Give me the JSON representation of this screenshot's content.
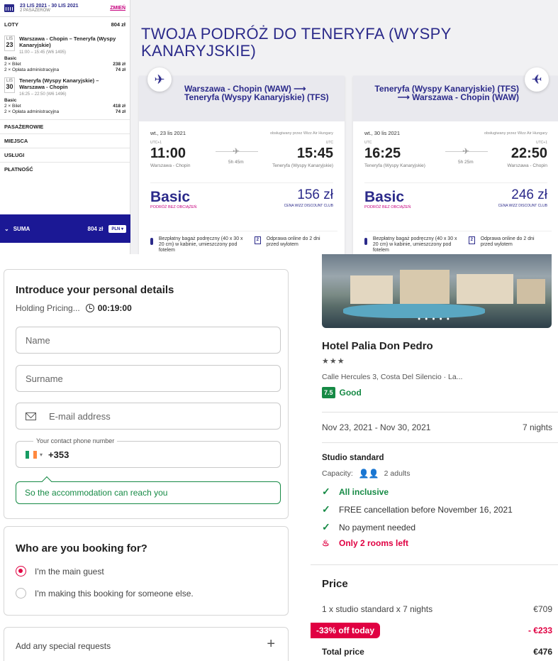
{
  "wizz": {
    "sidebar": {
      "dates": "23 LIS 2021 - 30 LIS 2021",
      "passengers": "2 PASAŻERÓW",
      "change": "ZMIEŃ",
      "flights_label": "LOTY",
      "flights_total": "804 zł",
      "out": {
        "month": "LIS",
        "day": "23",
        "route": "Warszawa - Chopin – Teneryfa (Wyspy Kanaryjskie)",
        "time": "11:00 – 15:45 (W6 1495)",
        "fare": "Basic",
        "ticket": "2 × Bilet",
        "ticket_price": "238 zł",
        "fee": "2 × Opłata administracyjna",
        "fee_price": "74 zł"
      },
      "ret": {
        "month": "LIS",
        "day": "30",
        "route": "Teneryfa (Wyspy Kanaryjskie) – Warszawa - Chopin",
        "time": "16:25 – 22:50 (W6 1496)",
        "fare": "Basic",
        "ticket": "2 × Bilet",
        "ticket_price": "418 zł",
        "fee": "2 × Opłata administracyjna",
        "fee_price": "74 zł"
      },
      "sections": [
        "PASAŻEROWIE",
        "MIEJSCA",
        "USŁUGI",
        "PŁATNOŚĆ"
      ],
      "sum_label": "SUMA",
      "sum_value": "804 zł",
      "currency": "PLN"
    },
    "title": "TWOJA PODRÓŻ DO TENERYFA (WYSPY KANARYJSKIE)",
    "cards": [
      {
        "route": "Warszawa - Chopin (WAW) ⟶ Teneryfa (Wyspy Kanaryjskie) (TFS)",
        "date": "wt., 23 lis 2021",
        "operator": "obsługiwany przez Wizz Air Hungary",
        "dep": "11:00",
        "arr": "15:45",
        "dep_tz": "UTC+1",
        "arr_tz": "UTC",
        "dep_city": "Warszawa - Chopin",
        "arr_city": "Teneryfa (Wyspy Kanaryjskie)",
        "duration": "5h 45m",
        "fare": "Basic",
        "fare_sub": "PODRÓŻ BEZ OBCIĄŻEŃ",
        "price": "156 zł",
        "price_sub": "CENA WIZZ DISCOUNT CLUB",
        "bag": "Bezpłatny bagaż podręczny (40 x 30 x 20 cm) w kabinie, umieszczony pod fotelem",
        "checkin": "Odprawa online do 2 dni przed wylotem",
        "cal_num": "2"
      },
      {
        "route": "Teneryfa (Wyspy Kanaryjskie) (TFS) ⟶ Warszawa - Chopin (WAW)",
        "date": "wt., 30 lis 2021",
        "operator": "obsługiwany przez Wizz Air Hungary",
        "dep": "16:25",
        "arr": "22:50",
        "dep_tz": "UTC",
        "arr_tz": "UTC+1",
        "dep_city": "Teneryfa (Wyspy Kanaryjskie)",
        "arr_city": "Warszawa - Chopin",
        "duration": "5h 25m",
        "fare": "Basic",
        "fare_sub": "PODRÓŻ BEZ OBCIĄŻEŃ",
        "price": "246 zł",
        "price_sub": "CENA WIZZ DISCOUNT CLUB",
        "bag": "Bezpłatny bagaż podręczny (40 x 30 x 20 cm) w kabinie, umieszczony pod fotelem",
        "checkin": "Odprawa online do 2 dni przed wylotem",
        "cal_num": "2"
      }
    ]
  },
  "form": {
    "title": "Introduce your personal details",
    "holding": "Holding Pricing...",
    "timer": "00:19:00",
    "name_ph": "Name",
    "surname_ph": "Surname",
    "email_ph": "E-mail address",
    "phone_label": "Your contact phone number",
    "phone_code": "+353",
    "hint": "So the accommodation can reach you",
    "booking_title": "Who are you booking for?",
    "opt_main": "I'm the main guest",
    "opt_other": "I'm making this booking for someone else.",
    "special": "Add any special requests",
    "plus": "+"
  },
  "hotel": {
    "name": "Hotel Palia Don Pedro",
    "stars": "★★★",
    "address": "Calle Hercules 3, Costa Del Silencio · La...",
    "score": "7.5",
    "score_label": "Good",
    "dates": "Nov 23, 2021 - Nov 30, 2021",
    "nights": "7 nights",
    "room": "Studio standard",
    "capacity_label": "Capacity:",
    "capacity": "2 adults",
    "features": [
      "All inclusive",
      "FREE cancellation before November 16, 2021",
      "No payment needed"
    ],
    "alert": "Only 2 rooms left",
    "price_title": "Price",
    "line1_label": "1 x studio standard x 7 nights",
    "line1_value": "€709",
    "disc_label": "-33% off today",
    "disc_value": "- €233",
    "total_label": "Total price",
    "total_value": "€476",
    "accent": "#e00042",
    "green": "#168a45",
    "wizz_blue": "#2b2a8a"
  }
}
